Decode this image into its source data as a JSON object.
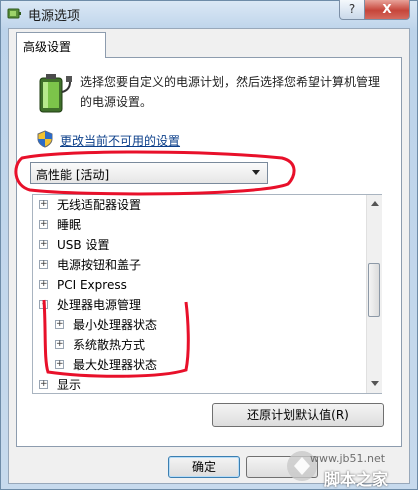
{
  "window": {
    "title": "电源选项",
    "help_label": "?",
    "close_label": "X"
  },
  "tab": {
    "label": "高级设置"
  },
  "description": "选择您要自定义的电源计划，然后选择您希望计算机管理的电源设置。",
  "change_link": "更改当前不可用的设置",
  "plan_select": {
    "selected": "高性能 [活动]"
  },
  "tree": [
    {
      "label": "无线适配器设置",
      "sign": "+",
      "level": 0
    },
    {
      "label": "睡眠",
      "sign": "+",
      "level": 0
    },
    {
      "label": "USB 设置",
      "sign": "+",
      "level": 0
    },
    {
      "label": "电源按钮和盖子",
      "sign": "+",
      "level": 0
    },
    {
      "label": "PCI Express",
      "sign": "+",
      "level": 0
    },
    {
      "label": "处理器电源管理",
      "sign": "-",
      "level": 0
    },
    {
      "label": "最小处理器状态",
      "sign": "+",
      "level": 1
    },
    {
      "label": "系统散热方式",
      "sign": "+",
      "level": 1
    },
    {
      "label": "最大处理器状态",
      "sign": "+",
      "level": 1
    },
    {
      "label": "显示",
      "sign": "+",
      "level": 0
    }
  ],
  "buttons": {
    "restore": "还原计划默认值(R)",
    "ok": "确定"
  },
  "watermark": {
    "site": "www.jb51.net",
    "brand": "脚本之家"
  },
  "colors": {
    "annotation": "#e8102a",
    "link": "#0b3f8a",
    "close": "#c6453a"
  }
}
